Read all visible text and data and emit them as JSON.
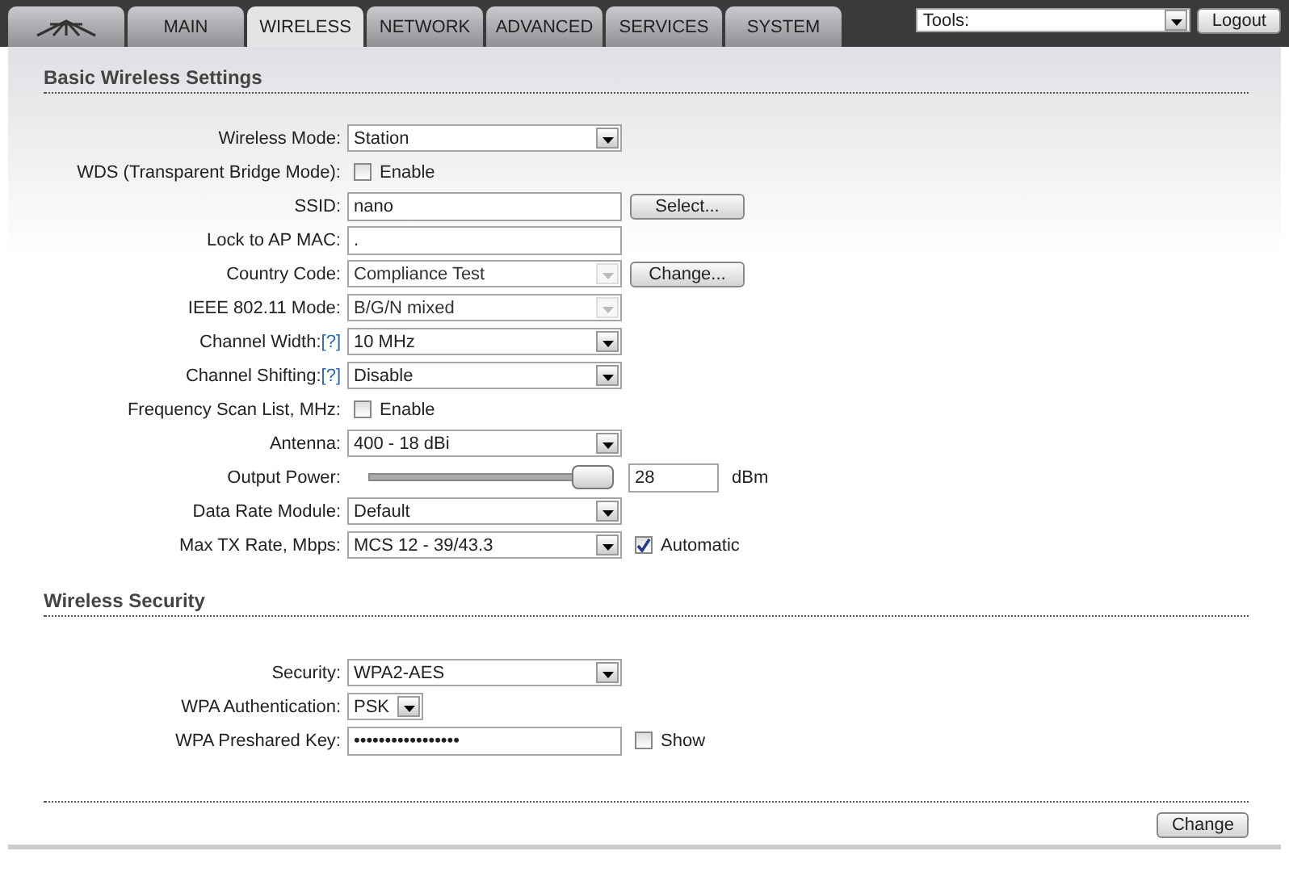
{
  "tabs": [
    {
      "kind": "logo",
      "selected": false
    },
    {
      "kind": "text",
      "label": "MAIN",
      "selected": false
    },
    {
      "kind": "text",
      "label": "WIRELESS",
      "selected": true
    },
    {
      "kind": "text",
      "label": "NETWORK",
      "selected": false
    },
    {
      "kind": "text",
      "label": "ADVANCED",
      "selected": false
    },
    {
      "kind": "text",
      "label": "SERVICES",
      "selected": false
    },
    {
      "kind": "text",
      "label": "SYSTEM",
      "selected": false
    }
  ],
  "tools": {
    "value": "Tools:",
    "button": "Logout"
  },
  "sections": [
    {
      "title": "Basic Wireless Settings",
      "rows": [
        {
          "kind": "select",
          "label": "Wireless Mode:",
          "value": "Station",
          "disabled": false
        },
        {
          "kind": "checkbox",
          "label": "WDS (Transparent Bridge Mode):",
          "checked": false,
          "text": "Enable"
        },
        {
          "kind": "input",
          "label": "SSID:",
          "value": "nano",
          "button": "Select..."
        },
        {
          "kind": "input",
          "label": "Lock to AP MAC:",
          "value": "."
        },
        {
          "kind": "select",
          "label": "Country Code:",
          "value": "Compliance Test",
          "disabled": true,
          "button": "Change..."
        },
        {
          "kind": "select",
          "label": "IEEE 802.11 Mode:",
          "value": "B/G/N mixed",
          "disabled": true
        },
        {
          "kind": "select",
          "label": "Channel Width:",
          "help": "[?]",
          "value": "10 MHz",
          "disabled": false
        },
        {
          "kind": "select",
          "label": "Channel Shifting:",
          "help": "[?]",
          "value": "Disable",
          "disabled": false
        },
        {
          "kind": "checkbox",
          "label": "Frequency Scan List, MHz:",
          "checked": false,
          "text": "Enable"
        },
        {
          "kind": "select",
          "label": "Antenna:",
          "value": "400 - 18 dBi",
          "disabled": false
        },
        {
          "kind": "slider",
          "label": "Output Power:",
          "level": 1,
          "value": "28",
          "unit": "dBm"
        },
        {
          "kind": "select",
          "label": "Data Rate Module:",
          "value": "Default",
          "disabled": false
        },
        {
          "kind": "select",
          "label": "Max TX Rate, Mbps:",
          "value": "MCS 12 - 39/43.3",
          "disabled": false,
          "option": {
            "text": "Automatic",
            "checked": true
          }
        }
      ]
    },
    {
      "title": "Wireless Security",
      "rows": [
        {
          "kind": "select",
          "label": "Security:",
          "value": "WPA2-AES",
          "disabled": false
        },
        {
          "kind": "short_select",
          "label": "WPA Authentication:",
          "value": "PSK",
          "disabled": false
        },
        {
          "kind": "input",
          "label": "WPA Preshared Key:",
          "value": "•••••••••••••••••",
          "option": {
            "text": "Show",
            "checked": false
          }
        }
      ]
    }
  ],
  "footer_button": "Change"
}
